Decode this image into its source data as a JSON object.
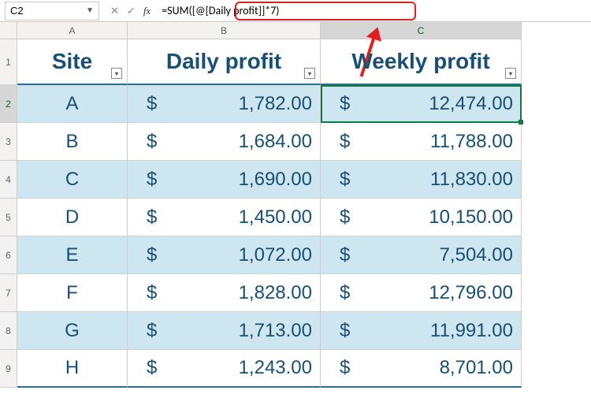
{
  "name_box": "C2",
  "formula": "=SUM([@[Daily profit]]*7)",
  "columns": [
    "A",
    "B",
    "C"
  ],
  "headers": {
    "a": "Site",
    "b": "Daily profit",
    "c": "Weekly profit"
  },
  "active_cell": "C2",
  "col_header_active": "C",
  "row_header_active": "2",
  "currency": "$",
  "rows": [
    {
      "n": "2",
      "site": "A",
      "daily": "1,782.00",
      "weekly": "12,474.00",
      "striped": true
    },
    {
      "n": "3",
      "site": "B",
      "daily": "1,684.00",
      "weekly": "11,788.00",
      "striped": false
    },
    {
      "n": "4",
      "site": "C",
      "daily": "1,690.00",
      "weekly": "11,830.00",
      "striped": true
    },
    {
      "n": "5",
      "site": "D",
      "daily": "1,450.00",
      "weekly": "10,150.00",
      "striped": false
    },
    {
      "n": "6",
      "site": "E",
      "daily": "1,072.00",
      "weekly": "7,504.00",
      "striped": true
    },
    {
      "n": "7",
      "site": "F",
      "daily": "1,828.00",
      "weekly": "12,796.00",
      "striped": false
    },
    {
      "n": "8",
      "site": "G",
      "daily": "1,713.00",
      "weekly": "11,991.00",
      "striped": true
    },
    {
      "n": "9",
      "site": "H",
      "daily": "1,243.00",
      "weekly": "8,701.00",
      "striped": false
    }
  ]
}
